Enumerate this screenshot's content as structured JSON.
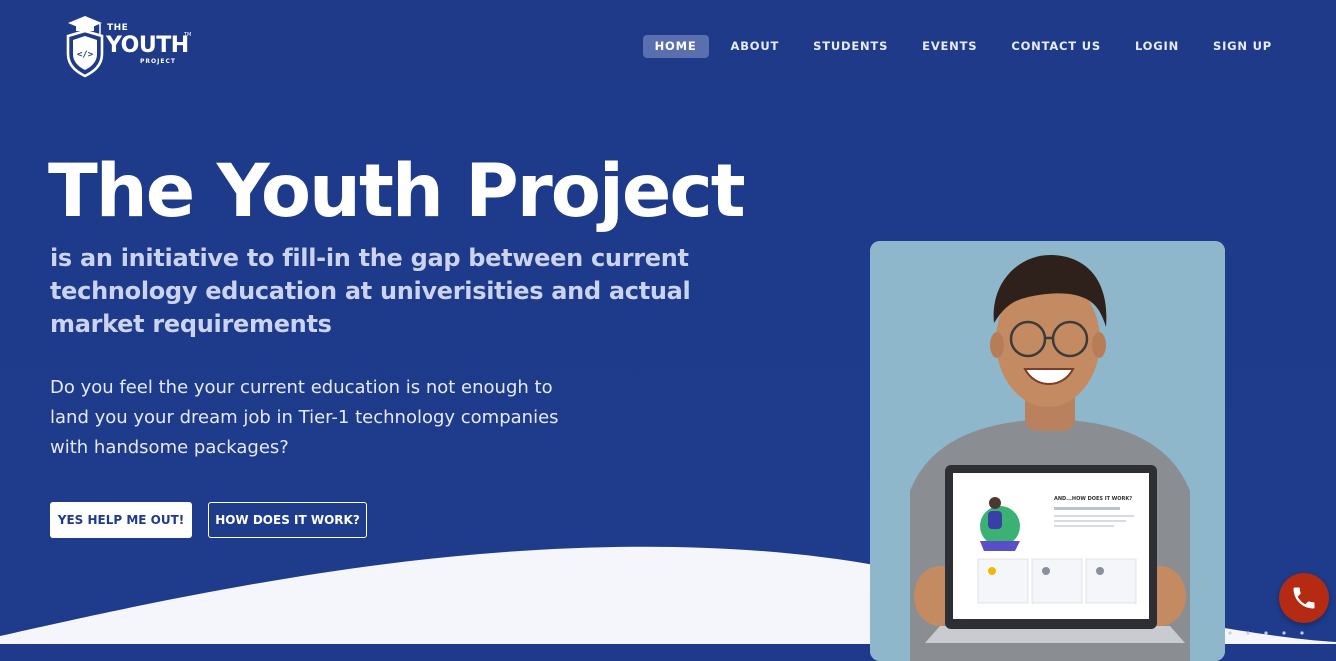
{
  "brand": {
    "logo_the": "THE",
    "logo_youth": "YOUTH",
    "logo_project": "PROJECT",
    "logo_tm": "TM",
    "logo_code": "</>"
  },
  "nav": {
    "items": [
      {
        "label": "HOME",
        "active": true
      },
      {
        "label": "ABOUT",
        "active": false
      },
      {
        "label": "STUDENTS",
        "active": false
      },
      {
        "label": "EVENTS",
        "active": false
      },
      {
        "label": "CONTACT US",
        "active": false
      },
      {
        "label": "LOGIN",
        "active": false
      },
      {
        "label": "SIGN UP",
        "active": false
      }
    ]
  },
  "hero": {
    "title": "The Youth Project",
    "subtitle": "is an initiative to fill-in the gap between current technology education at univerisities and actual market requirements",
    "body": "Do you feel the your current education is not enough to land you your dream job in Tier-1 technology companies with handsome packages?",
    "primary_button": "YES HELP ME OUT!",
    "secondary_button": "HOW DOES IT WORK?"
  },
  "laptop_screen": {
    "heading": "AND...HOW DOES IT WORK?"
  },
  "colors": {
    "background": "#1e3a89",
    "active_nav": "#5a6fad",
    "subtitle": "#cbd3ef",
    "wave": "#f4f6fb",
    "phone_fab": "#b52a12"
  },
  "icons": {
    "logo": "shield-graduation-cap-icon",
    "fab": "phone-icon"
  }
}
